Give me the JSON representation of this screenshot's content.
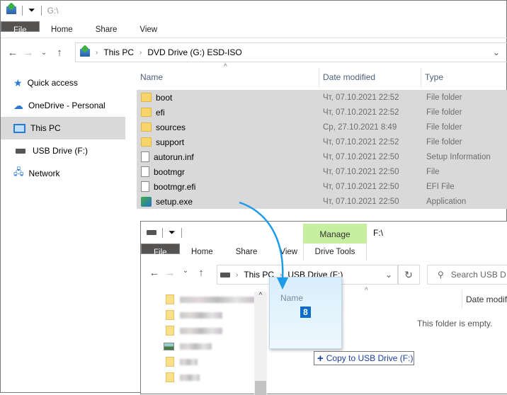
{
  "w1": {
    "title": "G:\\",
    "tabs": [
      "File",
      "Home",
      "Share",
      "View"
    ],
    "breadcrumb": [
      "This PC",
      "DVD Drive (G:) ESD-ISO"
    ],
    "sidebar": [
      {
        "label": "Quick access",
        "icon": "star-icon"
      },
      {
        "label": "OneDrive - Personal",
        "icon": "cloud-icon"
      },
      {
        "label": "This PC",
        "icon": "computer-icon",
        "selected": true
      },
      {
        "label": "USB Drive (F:)",
        "icon": "usb-drive-icon"
      },
      {
        "label": "Network",
        "icon": "network-icon"
      }
    ],
    "columns": [
      "Name",
      "Date modified",
      "Type"
    ],
    "files": [
      {
        "name": "boot",
        "date": "Чт, 07.10.2021 22:52",
        "type": "File folder",
        "icon": "folder"
      },
      {
        "name": "efi",
        "date": "Чт, 07.10.2021 22:52",
        "type": "File folder",
        "icon": "folder"
      },
      {
        "name": "sources",
        "date": "Ср, 27.10.2021 8:49",
        "type": "File folder",
        "icon": "folder"
      },
      {
        "name": "support",
        "date": "Чт, 07.10.2021 22:52",
        "type": "File folder",
        "icon": "folder"
      },
      {
        "name": "autorun.inf",
        "date": "Чт, 07.10.2021 22:50",
        "type": "Setup Information",
        "icon": "settings-file"
      },
      {
        "name": "bootmgr",
        "date": "Чт, 07.10.2021 22:50",
        "type": "File",
        "icon": "file"
      },
      {
        "name": "bootmgr.efi",
        "date": "Чт, 07.10.2021 22:50",
        "type": "EFI File",
        "icon": "file"
      },
      {
        "name": "setup.exe",
        "date": "Чт, 07.10.2021 22:50",
        "type": "Application",
        "icon": "exe"
      }
    ]
  },
  "w2": {
    "title": "F:\\",
    "manage": "Manage",
    "drive_tools": "Drive Tools",
    "tabs": [
      "File",
      "Home",
      "Share",
      "View"
    ],
    "breadcrumb": [
      "This PC",
      "USB Drive (F:)"
    ],
    "search_placeholder": "Search USB D",
    "columns": [
      "Name",
      "Date modif"
    ],
    "empty": "This folder is empty."
  },
  "drag": {
    "header": "Name",
    "count": "8",
    "tooltip": "Copy to USB Drive (F:)"
  },
  "colors": {
    "accent": "#1e9be8",
    "manage": "#c6efa0",
    "selection": "#d9d9d9"
  }
}
